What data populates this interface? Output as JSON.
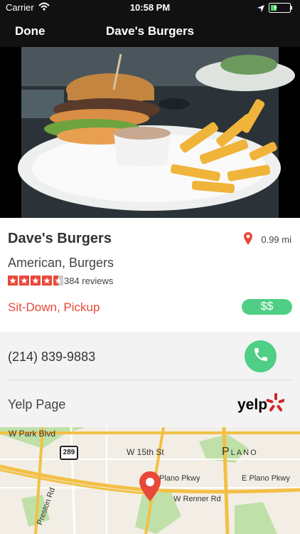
{
  "status": {
    "carrier": "Carrier",
    "time": "10:58 PM"
  },
  "nav": {
    "done_label": "Done",
    "title": "Dave's Burgers"
  },
  "restaurant": {
    "name": "Dave's Burgers",
    "distance": "0.99 mi",
    "cuisine": "American, Burgers",
    "rating": 4.5,
    "reviews": "384 reviews",
    "service": "Sit-Down, Pickup",
    "price": "$$"
  },
  "contact": {
    "phone": "(214) 839-9883",
    "yelp_label": "Yelp Page",
    "yelp_logo": "yelp"
  },
  "map": {
    "labels": {
      "w_park": "W Park Blvd",
      "highway": "289",
      "w15": "W 15th St",
      "plano": "Plano",
      "plano_pkwy": "Plano Pkwy",
      "e_plano_pkwy": "E Plano Pkwy",
      "renner": "W Renner Rd",
      "preston": "Preston Rd"
    }
  },
  "colors": {
    "accent": "#e8483a",
    "green": "#4fcf85"
  }
}
